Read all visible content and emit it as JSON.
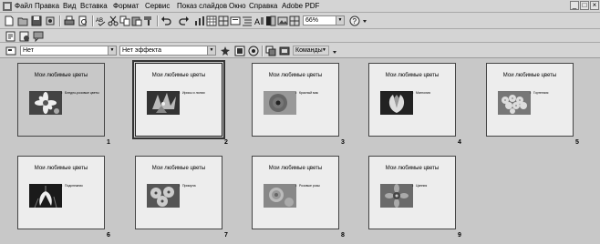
{
  "menu": [
    "Файл",
    "Правка",
    "Вид",
    "Вставка",
    "Формат",
    "Сервис",
    "Показ слайдов",
    "Окно",
    "Справка",
    "Adobe PDF"
  ],
  "window_buttons": [
    "_",
    "□",
    "×"
  ],
  "zoom": "66%",
  "transition_combo": "Нет",
  "effect_combo": "Нет эффекта",
  "commands_label": "Команды",
  "slides": [
    {
      "title": "Мои любимые цветы",
      "bullet": "Бледно-розовые цветы",
      "num": "1",
      "flower": "daisy"
    },
    {
      "title": "Мои любимые цветы",
      "bullet": "Ирисы и лилии",
      "num": "2",
      "flower": "iris"
    },
    {
      "title": "Мои любимые цветы",
      "bullet": "Красный мак",
      "num": "3",
      "flower": "poppy"
    },
    {
      "title": "Мои любимые цветы",
      "bullet": "Магнолия",
      "num": "4",
      "flower": "magnolia"
    },
    {
      "title": "Мои любимые цветы",
      "bullet": "Гортензия",
      "num": "5",
      "flower": "hydrangea"
    },
    {
      "title": "Мои любимые цветы",
      "bullet": "Подснежник",
      "num": "6",
      "flower": "snowdrop"
    },
    {
      "title": "Мои любимые цветы",
      "bullet": "Примула",
      "num": "7",
      "flower": "primula"
    },
    {
      "title": "Мои любимые цветы",
      "bullet": "Розовые розы",
      "num": "8",
      "flower": "roses"
    },
    {
      "title": "Мои любимые цветы",
      "bullet": "Цинния",
      "num": "9",
      "flower": "zinnia"
    }
  ]
}
